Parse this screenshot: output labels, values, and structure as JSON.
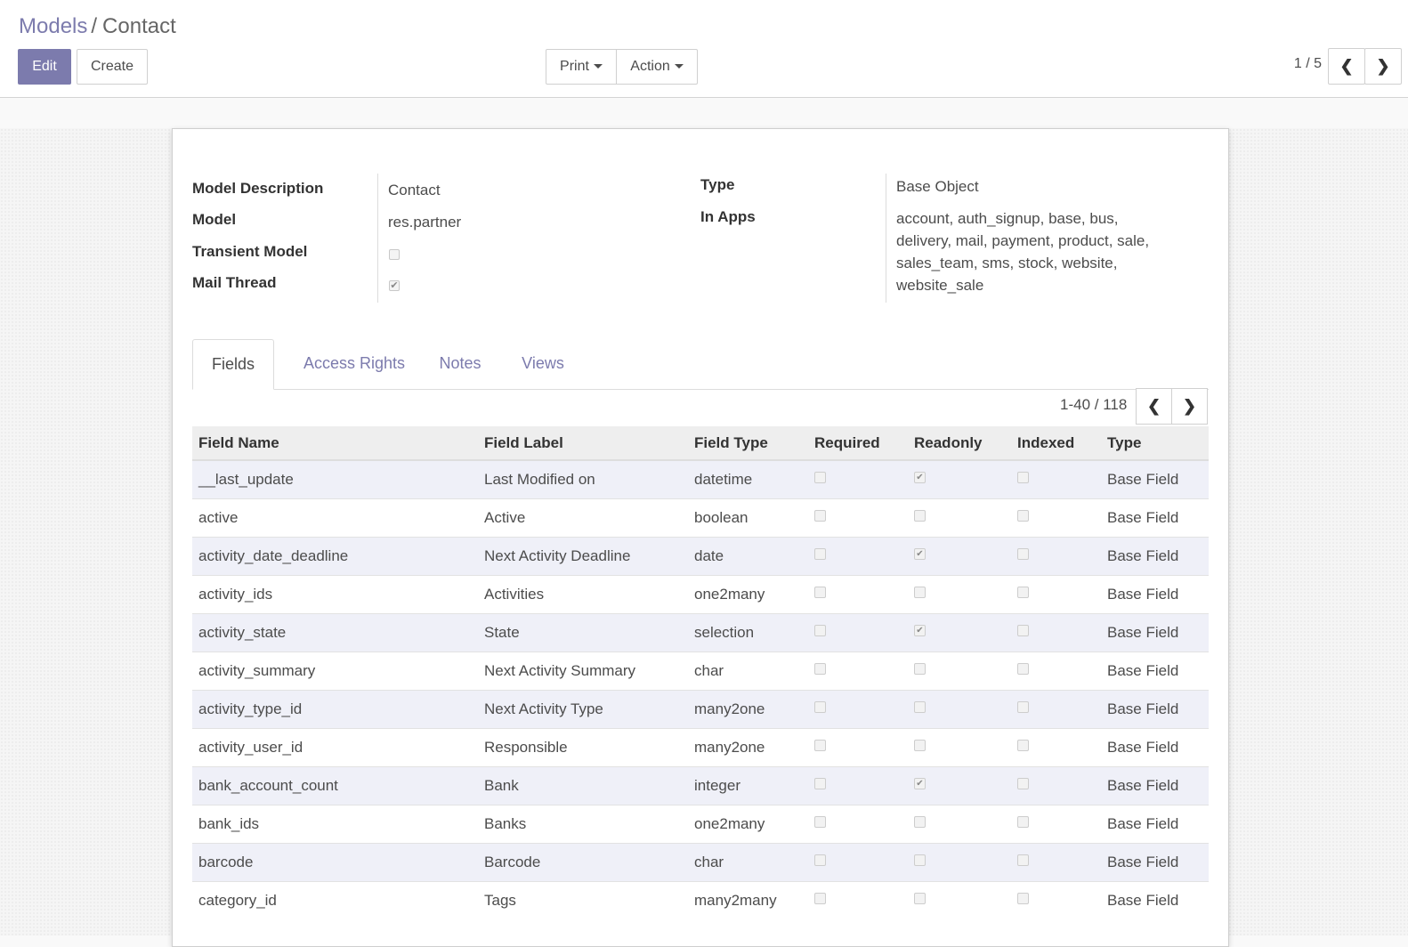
{
  "breadcrumb": {
    "parent": "Models",
    "separator": "/",
    "current": "Contact"
  },
  "toolbar": {
    "edit_label": "Edit",
    "create_label": "Create",
    "print_label": "Print",
    "action_label": "Action",
    "record_pager": "1 / 5"
  },
  "form": {
    "model_description_label": "Model Description",
    "model_description_value": "Contact",
    "model_label": "Model",
    "model_value": "res.partner",
    "transient_label": "Transient Model",
    "transient_checked": false,
    "mail_thread_label": "Mail Thread",
    "mail_thread_checked": true,
    "type_label": "Type",
    "type_value": "Base Object",
    "in_apps_label": "In Apps",
    "in_apps_lines": [
      "account, auth_signup, base, bus,",
      "delivery, mail, payment, product, sale,",
      "sales_team, sms, stock, website,",
      "website_sale"
    ]
  },
  "tabs": [
    "Fields",
    "Access Rights",
    "Notes",
    "Views"
  ],
  "active_tab": "Fields",
  "list_pager": "1-40 / 118",
  "table": {
    "columns": [
      "Field Name",
      "Field Label",
      "Field Type",
      "Required",
      "Readonly",
      "Indexed",
      "Type"
    ],
    "rows": [
      {
        "name": "__last_update",
        "label": "Last Modified on",
        "ftype": "datetime",
        "required": false,
        "readonly": true,
        "indexed": false,
        "type": "Base Field"
      },
      {
        "name": "active",
        "label": "Active",
        "ftype": "boolean",
        "required": false,
        "readonly": false,
        "indexed": false,
        "type": "Base Field"
      },
      {
        "name": "activity_date_deadline",
        "label": "Next Activity Deadline",
        "ftype": "date",
        "required": false,
        "readonly": true,
        "indexed": false,
        "type": "Base Field"
      },
      {
        "name": "activity_ids",
        "label": "Activities",
        "ftype": "one2many",
        "required": false,
        "readonly": false,
        "indexed": false,
        "type": "Base Field"
      },
      {
        "name": "activity_state",
        "label": "State",
        "ftype": "selection",
        "required": false,
        "readonly": true,
        "indexed": false,
        "type": "Base Field"
      },
      {
        "name": "activity_summary",
        "label": "Next Activity Summary",
        "ftype": "char",
        "required": false,
        "readonly": false,
        "indexed": false,
        "type": "Base Field"
      },
      {
        "name": "activity_type_id",
        "label": "Next Activity Type",
        "ftype": "many2one",
        "required": false,
        "readonly": false,
        "indexed": false,
        "type": "Base Field"
      },
      {
        "name": "activity_user_id",
        "label": "Responsible",
        "ftype": "many2one",
        "required": false,
        "readonly": false,
        "indexed": false,
        "type": "Base Field"
      },
      {
        "name": "bank_account_count",
        "label": "Bank",
        "ftype": "integer",
        "required": false,
        "readonly": true,
        "indexed": false,
        "type": "Base Field"
      },
      {
        "name": "bank_ids",
        "label": "Banks",
        "ftype": "one2many",
        "required": false,
        "readonly": false,
        "indexed": false,
        "type": "Base Field"
      },
      {
        "name": "barcode",
        "label": "Barcode",
        "ftype": "char",
        "required": false,
        "readonly": false,
        "indexed": false,
        "type": "Base Field"
      },
      {
        "name": "category_id",
        "label": "Tags",
        "ftype": "many2many",
        "required": false,
        "readonly": false,
        "indexed": false,
        "type": "Base Field"
      }
    ]
  },
  "colors": {
    "accent": "#7c7bad",
    "row_stripe": "#eff0f8",
    "header_bg": "#eeeeee"
  }
}
